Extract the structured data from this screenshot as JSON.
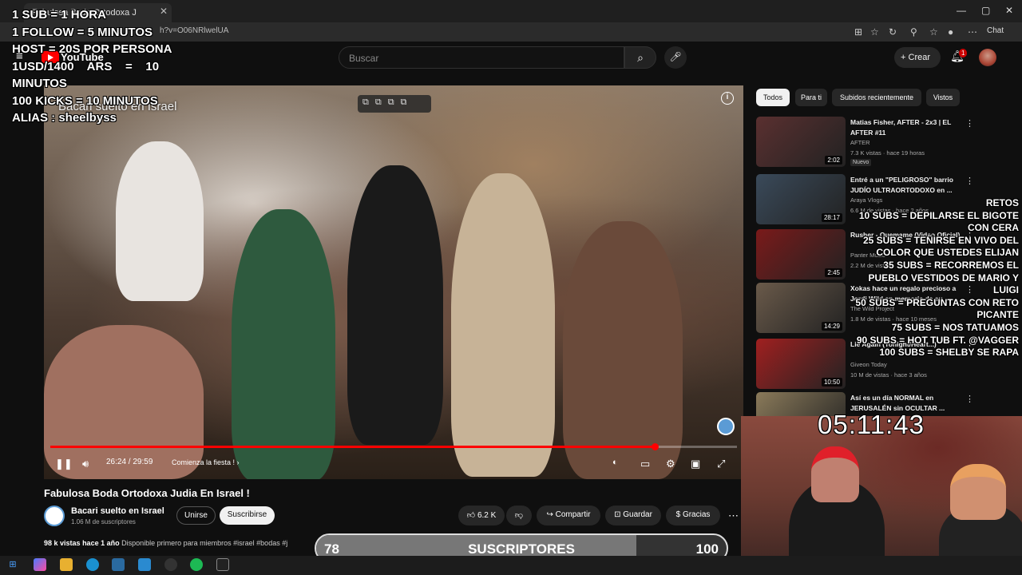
{
  "browser": {
    "tab_title": "Fabulosa Boda Ortodoxa J",
    "url": "h?v=O06NRlwelUA",
    "chat_label": "Chat"
  },
  "youtube": {
    "logo_text": "YouTube",
    "search_placeholder": "Buscar",
    "create_label": "Crear",
    "notif_count": "1"
  },
  "video": {
    "overlay_title": "Bacari suelto en Israel",
    "time": "26:24 / 29:59",
    "chapter": "Comienza la fiesta ! ›",
    "progress": 0.88,
    "title": "Fabulosa Boda Ortodoxa Judia En Israel !"
  },
  "channel": {
    "name": "Bacari suelto en Israel",
    "subs": "1.06 M de suscriptores",
    "join_label": "Unirse",
    "subscribe_label": "Suscribirse"
  },
  "actions": {
    "likes": "6.2 K",
    "share": "Compartir",
    "save": "Guardar",
    "thanks": "Gracias"
  },
  "description": {
    "views": "98 k vistas",
    "age": "hace 1 año",
    "rest": "Disponible primero para miembros  #israel #bodas #j"
  },
  "chips": [
    "Todos",
    "Para ti",
    "Subidos recientemente",
    "Vistos"
  ],
  "recommendations": [
    {
      "title": "Matias Fisher, AFTER - 2x3 | EL AFTER #11",
      "channel": "AFTER",
      "meta": "7.3 K vistas · hace 19 horas",
      "badge": "Nuevo",
      "duration": "2:02",
      "color": "#5a3030"
    },
    {
      "title": "Entré a un \"PELIGROSO\" barrio JUDÍO ULTRAORTODOXO en ...",
      "channel": "Araya Vlogs",
      "meta": "6.6 M de vistas · hace 2 años",
      "badge": "",
      "duration": "28:17",
      "color": "#3a4a5a"
    },
    {
      "title": "Rusher - Quemame (Video Oficial)",
      "channel": "Panter Music",
      "meta": "2.2 M de vistas",
      "badge": "",
      "duration": "2:45",
      "color": "#7a1a1a"
    },
    {
      "title": "Xokas hace un regalo precioso a Jordi Wild en memoria de su ...",
      "channel": "The Wild Project",
      "meta": "1.8 M de vistas · hace 10 meses",
      "badge": "",
      "duration": "14:29",
      "color": "#6a5a4a"
    },
    {
      "title": "Lie Again (Tonight/Heart...)",
      "channel": "Giveon Today",
      "meta": "10 M de vistas · hace 3 años",
      "badge": "",
      "duration": "10:50",
      "color": "#a02020"
    },
    {
      "title": "Así es un día NORMAL en JERUSALÉN sin OCULTAR ...",
      "channel": "",
      "meta": "",
      "badge": "",
      "duration": "",
      "color": "#8a7a5a"
    }
  ],
  "overlay_left": "1 SUB = 1 HORA\n1 FOLLOW = 5 MINUTOS\nHOST = 20S POR PERSONA\n1USD/1400    ARS    =    10\nMINUTOS\n100 KICKS = 10 MINUTOS\nALIAS : sheelbyss",
  "overlay_right": [
    "RETOS",
    "10 SUBS = DEPILARSE EL BIGOTE CON CERA",
    "25 SUBS = TEÑIRSE EN VIVO DEL COLOR QUE USTEDES ELIJAN",
    "35 SUBS = RECORREMOS EL PUEBLO VESTIDOS DE MARIO Y LUIGI",
    "50 SUBS = PREGUNTAS CON RETO PICANTE",
    "75 SUBS = NOS TATUAMOS",
    "90 SUBS  = HOT TUB FT. @VAGGER",
    "100 SUBS = SHELBY SE RAPA"
  ],
  "timer": "05:11:43",
  "sub_goal": {
    "current": "78",
    "label": "SUSCRIPTORES",
    "target": "100",
    "progress": 0.78
  },
  "colors": {
    "accent": "#ff0000",
    "bg": "#0f0f0f"
  }
}
